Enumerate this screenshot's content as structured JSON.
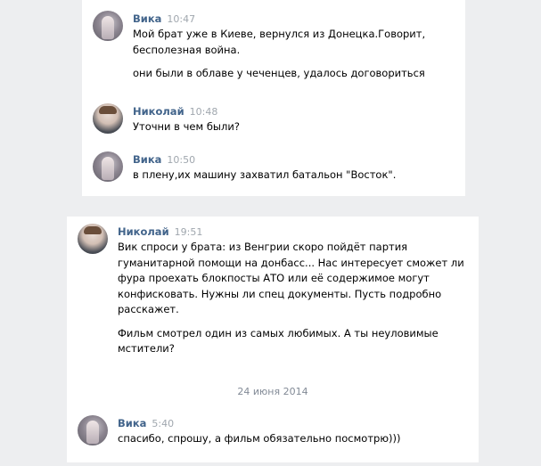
{
  "panel1": {
    "messages": [
      {
        "author": "Вика",
        "time": "10:47",
        "avatar": "vika-avatar",
        "paragraphs": [
          "Мой брат уже в Киеве, вернулся из Донецка.Говорит,\nбесполезная война.",
          "они были в облаве у чеченцев, удалось договориться"
        ]
      },
      {
        "author": "Николай",
        "time": "10:48",
        "avatar": "nikolai-avatar",
        "paragraphs": [
          "Уточни в чем были?"
        ]
      },
      {
        "author": "Вика",
        "time": "10:50",
        "avatar": "vika-avatar",
        "paragraphs": [
          "в плену,их машину захватил батальон \"Восток\"."
        ]
      }
    ]
  },
  "panel2": {
    "messages": [
      {
        "author": "Николай",
        "time": "19:51",
        "avatar": "nikolai-avatar",
        "paragraphs": [
          "Вик спроси у брата: из Венгрии скоро пойдёт партия\nгуманитарной помощи на донбасс... Нас интересует сможет ли\nфура проехать блокпосты АТО или её содержимое могут\nконфисковать. Нужны ли спец документы. Пусть подробно\nрасскажет.",
          "Фильм смотрел один из самых любимых. А ты неуловимые\nмстители?"
        ]
      },
      {
        "author": "Вика",
        "time": "5:40",
        "avatar": "vika-avatar",
        "paragraphs": [
          "спасибо, спрошу, а фильм обязательно посмотрю)))"
        ]
      }
    ],
    "date_separator": "24 июня 2014"
  },
  "colors": {
    "author": "#42648b",
    "time": "#a0a7ae",
    "background": "#edeef0",
    "panel": "#ffffff"
  }
}
